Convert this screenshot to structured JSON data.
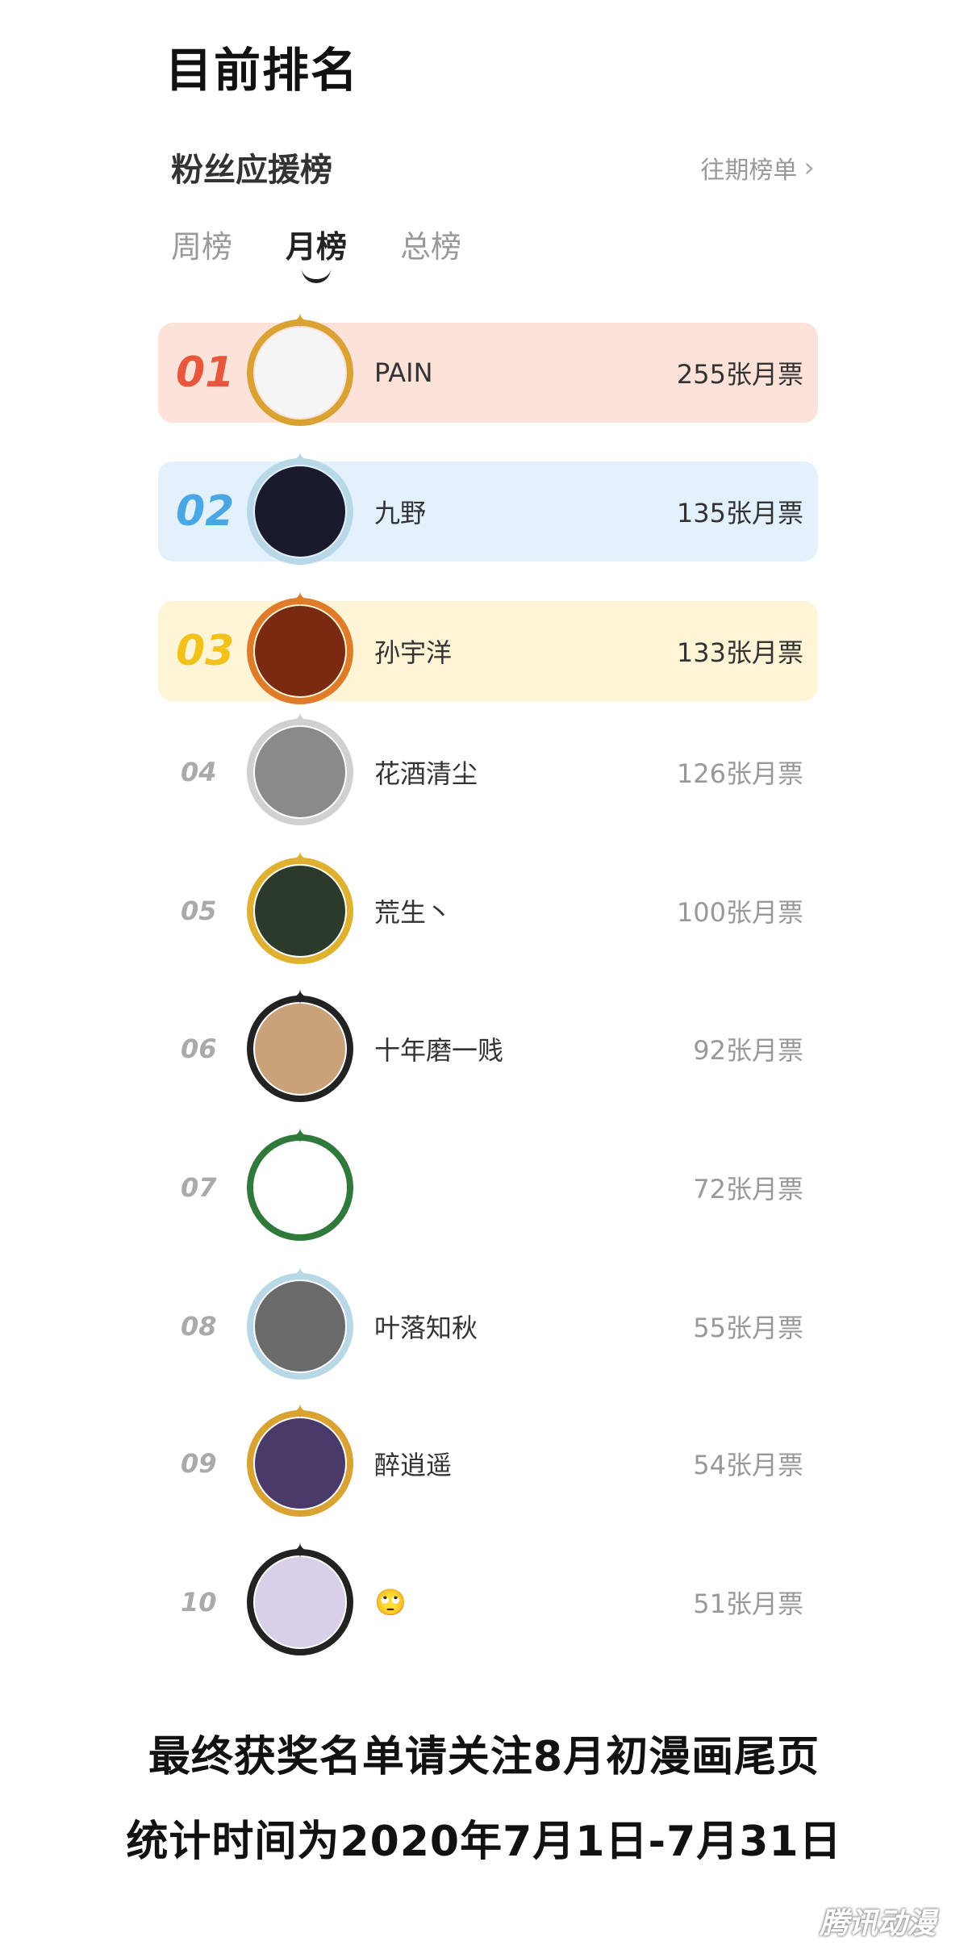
{
  "heading": "目前排名",
  "board": {
    "title": "粉丝应援榜",
    "history_link": "往期榜单"
  },
  "tabs": [
    {
      "label": "周榜",
      "active": false
    },
    {
      "label": "月榜",
      "active": true
    },
    {
      "label": "总榜",
      "active": false
    }
  ],
  "ranking": [
    {
      "rank": "01",
      "name": "PAIN",
      "votes": "255张月票",
      "bg": "#fde2da",
      "rank_color": "#e8573c"
    },
    {
      "rank": "02",
      "name": "九野",
      "votes": "135张月票",
      "bg": "#e3f1fd",
      "rank_color": "#49a7e6"
    },
    {
      "rank": "03",
      "name": "孙宇洋",
      "votes": "133张月票",
      "bg": "#fef4d6",
      "rank_color": "#f2c21a"
    },
    {
      "rank": "04",
      "name": "花酒清尘",
      "votes": "126张月票"
    },
    {
      "rank": "05",
      "name": "荒生丶",
      "votes": "100张月票"
    },
    {
      "rank": "06",
      "name": "十年磨一贱",
      "votes": "92张月票"
    },
    {
      "rank": "07",
      "name": "",
      "votes": "72张月票"
    },
    {
      "rank": "08",
      "name": "叶落知秋",
      "votes": "55张月票"
    },
    {
      "rank": "09",
      "name": "醉逍遥",
      "votes": "54张月票"
    },
    {
      "rank": "10",
      "name": "🙄",
      "votes": "51张月票"
    }
  ],
  "footer": {
    "line1": "最终获奖名单请关注8月初漫画尾页",
    "line2": "统计时间为2020年7月1日-7月31日"
  },
  "watermark": "腾讯动漫"
}
